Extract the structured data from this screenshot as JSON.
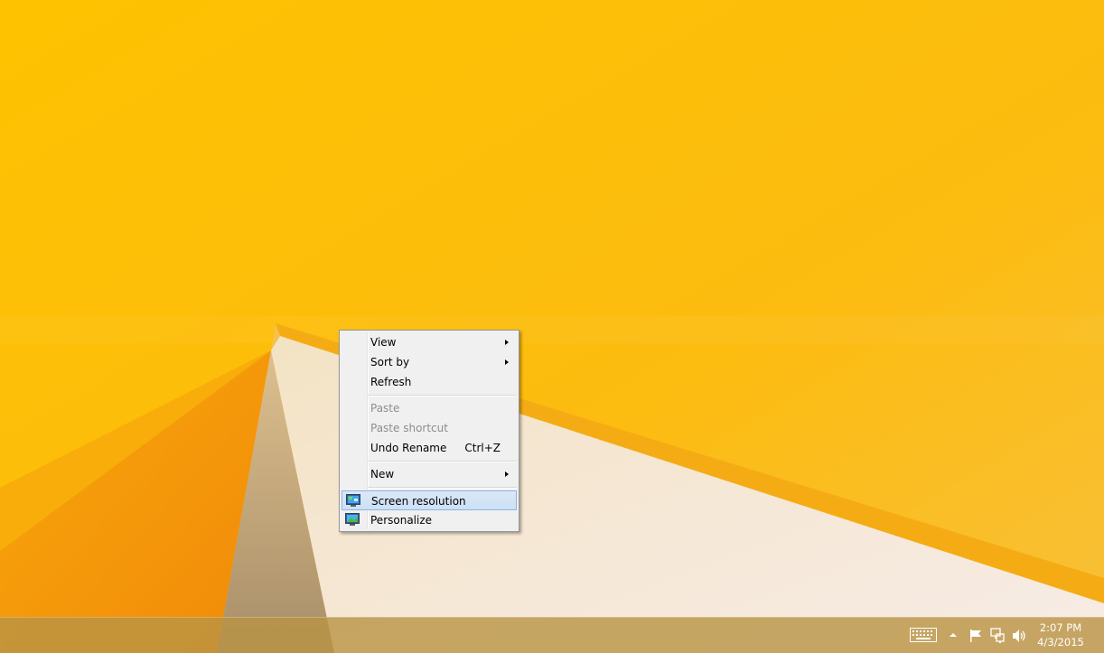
{
  "context_menu": {
    "items": [
      {
        "label": "View",
        "submenu": true,
        "enabled": true
      },
      {
        "label": "Sort by",
        "submenu": true,
        "enabled": true
      },
      {
        "label": "Refresh",
        "submenu": false,
        "enabled": true
      },
      {
        "label": "Paste",
        "submenu": false,
        "enabled": false
      },
      {
        "label": "Paste shortcut",
        "submenu": false,
        "enabled": false
      },
      {
        "label": "Undo Rename",
        "shortcut": "Ctrl+Z",
        "submenu": false,
        "enabled": true
      },
      {
        "label": "New",
        "submenu": true,
        "enabled": true
      },
      {
        "label": "Screen resolution",
        "icon": "screen-resolution-icon",
        "highlighted": true,
        "enabled": true
      },
      {
        "label": "Personalize",
        "icon": "personalize-icon",
        "enabled": true
      }
    ]
  },
  "taskbar": {
    "tray_icons": [
      "touch-keyboard-icon",
      "show-hidden-icons-chevron-icon",
      "action-center-flag-icon",
      "network-icon",
      "volume-icon"
    ],
    "clock": {
      "time": "2:07 PM",
      "date": "4/3/2015"
    }
  },
  "colors": {
    "wallpaper": "#fdc000",
    "highlight": "#cde0f6",
    "menu_bg": "#f0f0f0"
  }
}
